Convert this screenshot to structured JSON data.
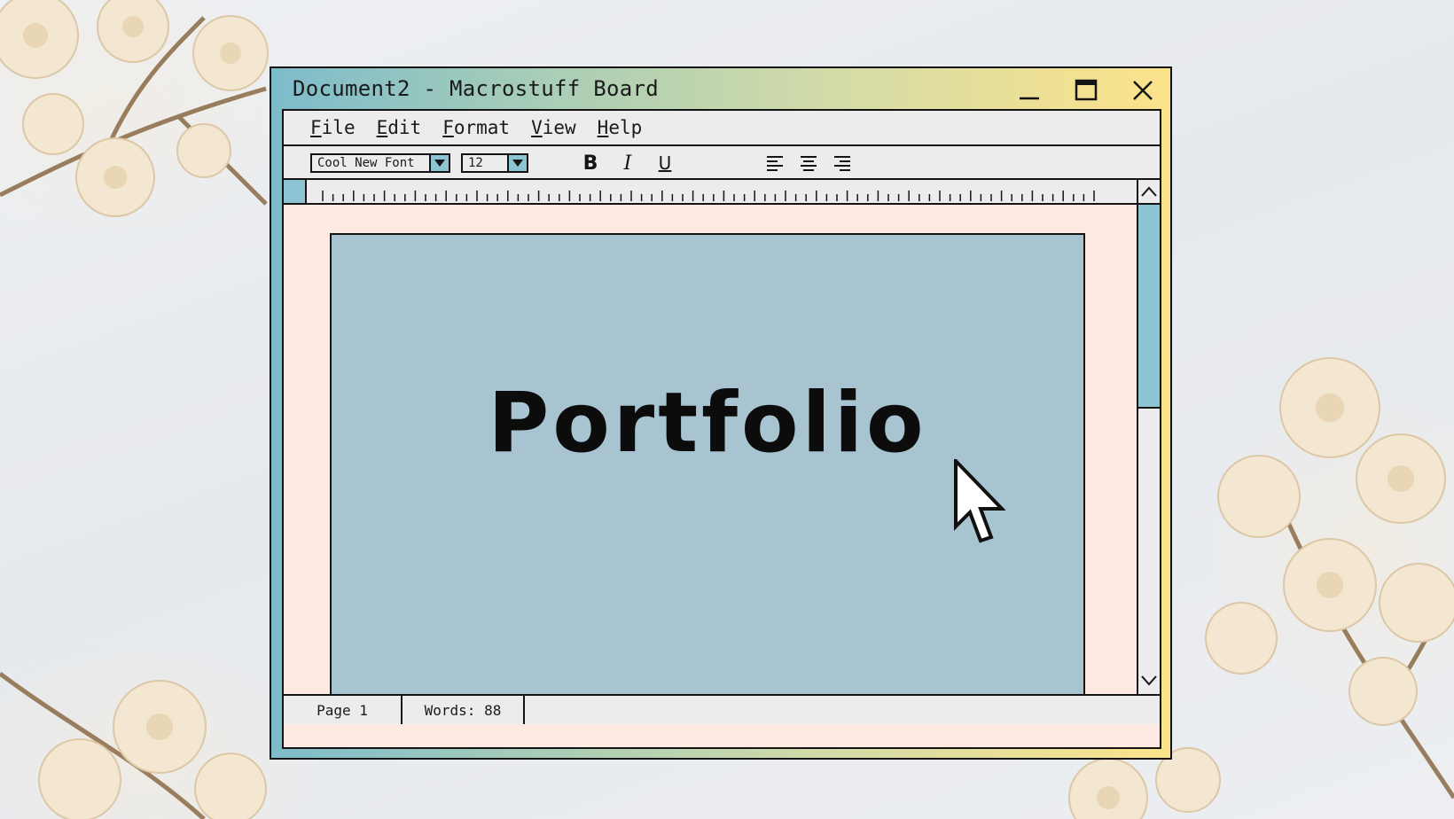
{
  "window": {
    "title": "Document2 - Macrostuff Board",
    "controls": [
      "minimize-icon",
      "maximize-icon",
      "close-icon"
    ]
  },
  "menu": {
    "items": [
      {
        "first": "F",
        "rest": "ile"
      },
      {
        "first": "E",
        "rest": "dit"
      },
      {
        "first": "F",
        "rest": "ormat"
      },
      {
        "first": "V",
        "rest": "iew"
      },
      {
        "first": "H",
        "rest": "elp"
      }
    ]
  },
  "toolbar": {
    "font_value": "Cool New Font",
    "size_value": "12",
    "bold_label": "B",
    "italic_label": "I",
    "underline_label": "U",
    "align_icons": [
      "align-left-icon",
      "align-center-icon",
      "align-right-icon"
    ]
  },
  "document": {
    "title": "Portfolio"
  },
  "status": {
    "page": "Page 1",
    "words": "Words: 88"
  },
  "colors": {
    "accent": "#8cc4d3",
    "page_background": "#a8c4d0",
    "document_background": "#ffe9e3",
    "chrome": "#ececec",
    "title_gradient_start": "#7dbccb",
    "title_gradient_end": "#fce38a"
  }
}
